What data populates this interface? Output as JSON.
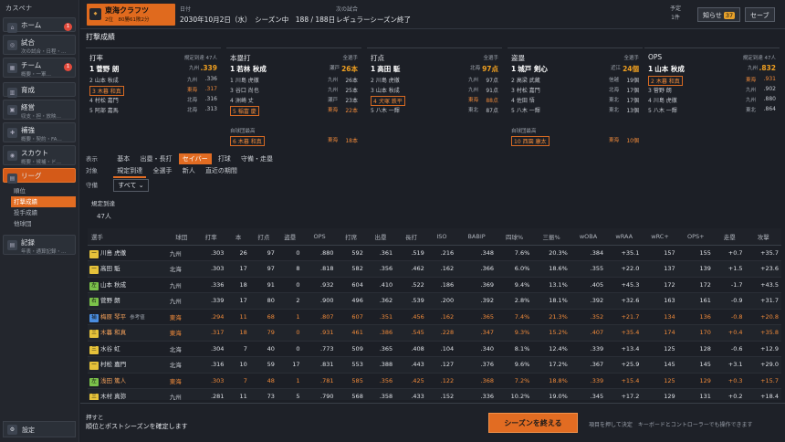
{
  "app_title": "カスペナ",
  "sidebar": {
    "items": [
      {
        "label": "ホーム",
        "sub": "",
        "badge": "1",
        "icon": "home-icon",
        "glyph": "⌂"
      },
      {
        "label": "試合",
        "sub": "次の試合・日程・…",
        "badge": "",
        "icon": "match-icon",
        "glyph": "◎"
      },
      {
        "label": "チーム",
        "sub": "概要・一軍…",
        "badge": "1",
        "icon": "team-icon",
        "glyph": "▦"
      },
      {
        "label": "育成",
        "sub": "",
        "badge": "",
        "icon": "training-icon",
        "glyph": "▥"
      },
      {
        "label": "経営",
        "sub": "収支・担・放映…",
        "badge": "",
        "icon": "finance-icon",
        "glyph": "▣"
      },
      {
        "label": "補強",
        "sub": "概要・契約・FA…",
        "badge": "",
        "icon": "reinforce-icon",
        "glyph": "✚"
      },
      {
        "label": "スカウト",
        "sub": "概要・候補・ド…",
        "badge": "",
        "icon": "scout-icon",
        "glyph": "◉"
      },
      {
        "label": "リーグ",
        "sub": "",
        "badge": "",
        "icon": "league-icon",
        "glyph": "▤"
      }
    ],
    "league_sub": [
      "順位",
      "打撃成績",
      "投手成績",
      "他球団"
    ],
    "record": {
      "label": "記録",
      "sub": "年表・通算記録・…"
    },
    "settings": "設定"
  },
  "top": {
    "team_name": "東海クラフツ",
    "team_rank": "2位",
    "team_record": "80勝61敗2分",
    "date_label": "日付",
    "date": "2030年10月2日（水）",
    "season": "シーズン中",
    "game_count": "188 / 188日",
    "next_label": "次の試合",
    "next_value": "レギュラーシーズン終了",
    "yotei_label": "予定",
    "yotei_count": "1件",
    "notify_label": "知らせ",
    "notify_count": "37",
    "save_label": "セーブ"
  },
  "section_title": "打撃成績",
  "leaders": [
    {
      "title": "打率",
      "scope": "規定到達 47人",
      "rows": [
        {
          "rank": "1",
          "name": "菅野 朗",
          "team": "九州",
          "value": ".339"
        },
        {
          "rank": "2",
          "name": "山本 秋成",
          "team": "九州",
          "value": ".336"
        },
        {
          "rank": "3",
          "name": "木暮 和真",
          "team": "東海",
          "value": ".317"
        },
        {
          "rank": "4",
          "name": "村松 嘉門",
          "team": "北海",
          "value": ".316"
        },
        {
          "rank": "5",
          "name": "阿部 嘉馬",
          "team": "北海",
          "value": ".313"
        }
      ],
      "note": "",
      "note_row": {
        "rank": "",
        "name": "",
        "team": "",
        "value": ""
      }
    },
    {
      "title": "本塁打",
      "scope": "全選手",
      "rows": [
        {
          "rank": "1",
          "name": "若林 秋成",
          "team": "瀬戸",
          "value": "26本"
        },
        {
          "rank": "1",
          "name": "川島 虎徹",
          "team": "九州",
          "value": "26本"
        },
        {
          "rank": "3",
          "name": "谷口 尚也",
          "team": "九州",
          "value": "25本"
        },
        {
          "rank": "4",
          "name": "洲崎 丈",
          "team": "瀬戸",
          "value": "23本"
        },
        {
          "rank": "5",
          "name": "稲富 慶",
          "team": "東海",
          "value": "22本"
        }
      ],
      "note": "自球団最高",
      "note_row": {
        "rank": "6",
        "name": "木暮 和真",
        "team": "東海",
        "value": "18本"
      }
    },
    {
      "title": "打点",
      "scope": "全選手",
      "rows": [
        {
          "rank": "1",
          "name": "高田 駈",
          "team": "北海",
          "value": "97点"
        },
        {
          "rank": "2",
          "name": "川島 虎徹",
          "team": "九州",
          "value": "97点"
        },
        {
          "rank": "3",
          "name": "山本 秋成",
          "team": "九州",
          "value": "91点"
        },
        {
          "rank": "4",
          "name": "犬塚 鉄平",
          "team": "東海",
          "value": "88点"
        },
        {
          "rank": "5",
          "name": "八木 一輝",
          "team": "東北",
          "value": "87点"
        }
      ],
      "note": "",
      "note_row": {
        "rank": "",
        "name": "",
        "team": "",
        "value": ""
      }
    },
    {
      "title": "盗塁",
      "scope": "全選手",
      "rows": [
        {
          "rank": "1",
          "name": "城戸 剣心",
          "team": "近江",
          "value": "24個"
        },
        {
          "rank": "2",
          "name": "高梁 武蔵",
          "team": "信越",
          "value": "19個"
        },
        {
          "rank": "3",
          "name": "村松 嘉門",
          "team": "北海",
          "value": "17個"
        },
        {
          "rank": "4",
          "name": "佐田 悟",
          "team": "東北",
          "value": "17個"
        },
        {
          "rank": "5",
          "name": "八木 一輝",
          "team": "東北",
          "value": "13個"
        }
      ],
      "note": "自球団最高",
      "note_row": {
        "rank": "10",
        "name": "西園 康太",
        "team": "東海",
        "value": "10個"
      }
    },
    {
      "title": "OPS",
      "scope": "規定到達 47人",
      "rows": [
        {
          "rank": "1",
          "name": "山本 秋成",
          "team": "九州",
          "value": ".832"
        },
        {
          "rank": "2",
          "name": "木暮 和真",
          "team": "東海",
          "value": ".931"
        },
        {
          "rank": "3",
          "name": "菅野 朗",
          "team": "九州",
          "value": ".902"
        },
        {
          "rank": "4",
          "name": "川島 虎徹",
          "team": "九州",
          "value": ".880"
        },
        {
          "rank": "5",
          "name": "八木 一輝",
          "team": "東北",
          "value": ".864"
        }
      ],
      "note": "",
      "note_row": {
        "rank": "",
        "name": "",
        "team": "",
        "value": ""
      }
    }
  ],
  "filters": {
    "display_label": "表示",
    "display_opts": [
      "基本",
      "出塁・長打",
      "セイバー",
      "打球",
      "守備・走塁"
    ],
    "target_label": "対象",
    "target_opts": [
      "規定到達",
      "全選手",
      "新人",
      "直近の期間"
    ],
    "pos_label": "守備",
    "pos_value": "すべて"
  },
  "qualified_label": "規定到達",
  "qualified_count": "47人",
  "table": {
    "headers": [
      "選手",
      "球団",
      "打率",
      "本",
      "打点",
      "盗塁",
      "OPS",
      "打席",
      "出塁",
      "長打",
      "ISO",
      "BABIP",
      "四球%",
      "三振%",
      "wOBA",
      "wRAA",
      "wRC+",
      "OPS+",
      "走塁",
      "攻撃"
    ],
    "rows": [
      {
        "pos": "一",
        "pc": "p-y",
        "name": "川島 虎徹",
        "ref": "",
        "team": "九州",
        "mine": false,
        "c": [
          ".303",
          "26",
          "97",
          "0",
          ".880",
          "592",
          ".361",
          ".519",
          ".216",
          ".348",
          "7.6%",
          "20.3%",
          ".384",
          "+35.1",
          "157",
          "155",
          "+0.7",
          "+35.7"
        ]
      },
      {
        "pos": "一",
        "pc": "p-y",
        "name": "高田 駈",
        "ref": "",
        "team": "北海",
        "mine": false,
        "c": [
          ".303",
          "17",
          "97",
          "8",
          ".818",
          "582",
          ".356",
          ".462",
          ".162",
          ".366",
          "6.0%",
          "18.6%",
          ".355",
          "+22.0",
          "137",
          "139",
          "+1.5",
          "+23.6"
        ]
      },
      {
        "pos": "左",
        "pc": "p-g",
        "name": "山本 秋成",
        "ref": "",
        "team": "九州",
        "mine": false,
        "c": [
          ".336",
          "18",
          "91",
          "0",
          ".932",
          "604",
          ".410",
          ".522",
          ".186",
          ".369",
          "9.4%",
          "13.1%",
          ".405",
          "+45.3",
          "172",
          "172",
          "-1.7",
          "+43.5"
        ]
      },
      {
        "pos": "右",
        "pc": "p-g",
        "name": "菅野 朗",
        "ref": "",
        "team": "九州",
        "mine": false,
        "c": [
          ".339",
          "17",
          "80",
          "2",
          ".900",
          "496",
          ".362",
          ".539",
          ".200",
          ".392",
          "2.8%",
          "18.1%",
          ".392",
          "+32.6",
          "163",
          "161",
          "-0.9",
          "+31.7"
        ]
      },
      {
        "pos": "捕",
        "pc": "p-b",
        "name": "梅原 琴平",
        "ref": "参考値",
        "team": "東海",
        "mine": true,
        "c": [
          ".294",
          "11",
          "68",
          "1",
          ".807",
          "607",
          ".351",
          ".456",
          ".162",
          ".365",
          "7.4%",
          "21.3%",
          ".352",
          "+21.7",
          "134",
          "136",
          "-0.8",
          "+20.8"
        ]
      },
      {
        "pos": "三",
        "pc": "p-y",
        "name": "木暮 和真",
        "ref": "",
        "team": "東海",
        "mine": true,
        "c": [
          ".317",
          "18",
          "79",
          "0",
          ".931",
          "461",
          ".386",
          ".545",
          ".228",
          ".347",
          "9.3%",
          "15.2%",
          ".407",
          "+35.4",
          "174",
          "170",
          "+0.4",
          "+35.8"
        ]
      },
      {
        "pos": "三",
        "pc": "p-y",
        "name": "水谷 虹",
        "ref": "",
        "team": "北海",
        "mine": false,
        "c": [
          ".304",
          "7",
          "40",
          "0",
          ".773",
          "509",
          ".365",
          ".408",
          ".104",
          ".340",
          "8.1%",
          "12.4%",
          ".339",
          "+13.4",
          "125",
          "128",
          "-0.6",
          "+12.9"
        ]
      },
      {
        "pos": "一",
        "pc": "p-y",
        "name": "村松 嘉門",
        "ref": "",
        "team": "北海",
        "mine": false,
        "c": [
          ".316",
          "10",
          "59",
          "17",
          ".831",
          "553",
          ".388",
          ".443",
          ".127",
          ".376",
          "9.6%",
          "17.2%",
          ".367",
          "+25.9",
          "145",
          "145",
          "+3.1",
          "+29.0"
        ]
      },
      {
        "pos": "左",
        "pc": "p-g",
        "name": "浅田 篤人",
        "ref": "",
        "team": "東海",
        "mine": true,
        "c": [
          ".303",
          "7",
          "48",
          "1",
          ".781",
          "585",
          ".356",
          ".425",
          ".122",
          ".368",
          "7.2%",
          "18.8%",
          ".339",
          "+15.4",
          "125",
          "129",
          "+0.3",
          "+15.7"
        ]
      },
      {
        "pos": "三",
        "pc": "p-y",
        "name": "木村 真弥",
        "ref": "",
        "team": "九州",
        "mine": false,
        "c": [
          ".281",
          "11",
          "73",
          "5",
          ".790",
          "568",
          ".358",
          ".433",
          ".152",
          ".336",
          "10.2%",
          "19.0%",
          ".345",
          "+17.2",
          "129",
          "131",
          "+0.2",
          "+18.4"
        ]
      }
    ]
  },
  "footer": {
    "line1": "押すと",
    "line2": "順位とポストシーズンを確定します",
    "button": "シーズンを終える",
    "hint": "項目を押して決定　キーボードとコントローラーでも操作できます"
  }
}
